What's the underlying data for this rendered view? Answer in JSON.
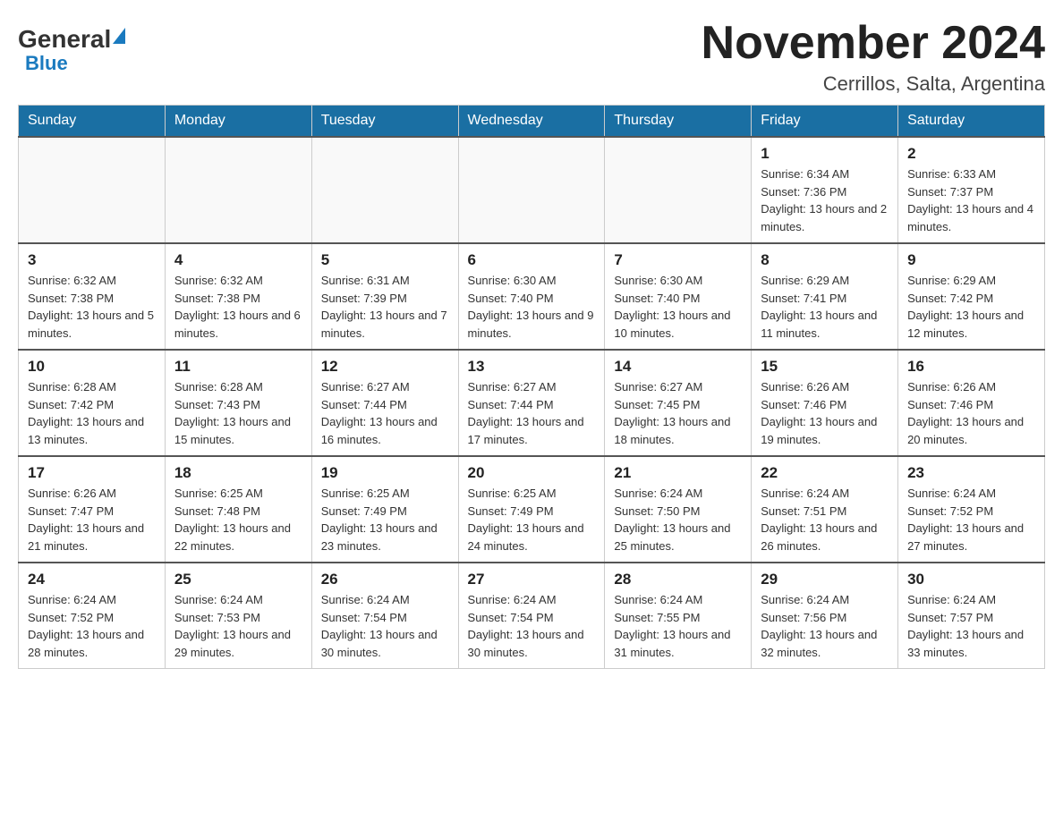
{
  "header": {
    "logo_text": "General",
    "logo_blue": "Blue",
    "month_title": "November 2024",
    "location": "Cerrillos, Salta, Argentina"
  },
  "days_of_week": [
    "Sunday",
    "Monday",
    "Tuesday",
    "Wednesday",
    "Thursday",
    "Friday",
    "Saturday"
  ],
  "weeks": [
    [
      {
        "day": "",
        "info": ""
      },
      {
        "day": "",
        "info": ""
      },
      {
        "day": "",
        "info": ""
      },
      {
        "day": "",
        "info": ""
      },
      {
        "day": "",
        "info": ""
      },
      {
        "day": "1",
        "info": "Sunrise: 6:34 AM\nSunset: 7:36 PM\nDaylight: 13 hours and 2 minutes."
      },
      {
        "day": "2",
        "info": "Sunrise: 6:33 AM\nSunset: 7:37 PM\nDaylight: 13 hours and 4 minutes."
      }
    ],
    [
      {
        "day": "3",
        "info": "Sunrise: 6:32 AM\nSunset: 7:38 PM\nDaylight: 13 hours and 5 minutes."
      },
      {
        "day": "4",
        "info": "Sunrise: 6:32 AM\nSunset: 7:38 PM\nDaylight: 13 hours and 6 minutes."
      },
      {
        "day": "5",
        "info": "Sunrise: 6:31 AM\nSunset: 7:39 PM\nDaylight: 13 hours and 7 minutes."
      },
      {
        "day": "6",
        "info": "Sunrise: 6:30 AM\nSunset: 7:40 PM\nDaylight: 13 hours and 9 minutes."
      },
      {
        "day": "7",
        "info": "Sunrise: 6:30 AM\nSunset: 7:40 PM\nDaylight: 13 hours and 10 minutes."
      },
      {
        "day": "8",
        "info": "Sunrise: 6:29 AM\nSunset: 7:41 PM\nDaylight: 13 hours and 11 minutes."
      },
      {
        "day": "9",
        "info": "Sunrise: 6:29 AM\nSunset: 7:42 PM\nDaylight: 13 hours and 12 minutes."
      }
    ],
    [
      {
        "day": "10",
        "info": "Sunrise: 6:28 AM\nSunset: 7:42 PM\nDaylight: 13 hours and 13 minutes."
      },
      {
        "day": "11",
        "info": "Sunrise: 6:28 AM\nSunset: 7:43 PM\nDaylight: 13 hours and 15 minutes."
      },
      {
        "day": "12",
        "info": "Sunrise: 6:27 AM\nSunset: 7:44 PM\nDaylight: 13 hours and 16 minutes."
      },
      {
        "day": "13",
        "info": "Sunrise: 6:27 AM\nSunset: 7:44 PM\nDaylight: 13 hours and 17 minutes."
      },
      {
        "day": "14",
        "info": "Sunrise: 6:27 AM\nSunset: 7:45 PM\nDaylight: 13 hours and 18 minutes."
      },
      {
        "day": "15",
        "info": "Sunrise: 6:26 AM\nSunset: 7:46 PM\nDaylight: 13 hours and 19 minutes."
      },
      {
        "day": "16",
        "info": "Sunrise: 6:26 AM\nSunset: 7:46 PM\nDaylight: 13 hours and 20 minutes."
      }
    ],
    [
      {
        "day": "17",
        "info": "Sunrise: 6:26 AM\nSunset: 7:47 PM\nDaylight: 13 hours and 21 minutes."
      },
      {
        "day": "18",
        "info": "Sunrise: 6:25 AM\nSunset: 7:48 PM\nDaylight: 13 hours and 22 minutes."
      },
      {
        "day": "19",
        "info": "Sunrise: 6:25 AM\nSunset: 7:49 PM\nDaylight: 13 hours and 23 minutes."
      },
      {
        "day": "20",
        "info": "Sunrise: 6:25 AM\nSunset: 7:49 PM\nDaylight: 13 hours and 24 minutes."
      },
      {
        "day": "21",
        "info": "Sunrise: 6:24 AM\nSunset: 7:50 PM\nDaylight: 13 hours and 25 minutes."
      },
      {
        "day": "22",
        "info": "Sunrise: 6:24 AM\nSunset: 7:51 PM\nDaylight: 13 hours and 26 minutes."
      },
      {
        "day": "23",
        "info": "Sunrise: 6:24 AM\nSunset: 7:52 PM\nDaylight: 13 hours and 27 minutes."
      }
    ],
    [
      {
        "day": "24",
        "info": "Sunrise: 6:24 AM\nSunset: 7:52 PM\nDaylight: 13 hours and 28 minutes."
      },
      {
        "day": "25",
        "info": "Sunrise: 6:24 AM\nSunset: 7:53 PM\nDaylight: 13 hours and 29 minutes."
      },
      {
        "day": "26",
        "info": "Sunrise: 6:24 AM\nSunset: 7:54 PM\nDaylight: 13 hours and 30 minutes."
      },
      {
        "day": "27",
        "info": "Sunrise: 6:24 AM\nSunset: 7:54 PM\nDaylight: 13 hours and 30 minutes."
      },
      {
        "day": "28",
        "info": "Sunrise: 6:24 AM\nSunset: 7:55 PM\nDaylight: 13 hours and 31 minutes."
      },
      {
        "day": "29",
        "info": "Sunrise: 6:24 AM\nSunset: 7:56 PM\nDaylight: 13 hours and 32 minutes."
      },
      {
        "day": "30",
        "info": "Sunrise: 6:24 AM\nSunset: 7:57 PM\nDaylight: 13 hours and 33 minutes."
      }
    ]
  ]
}
